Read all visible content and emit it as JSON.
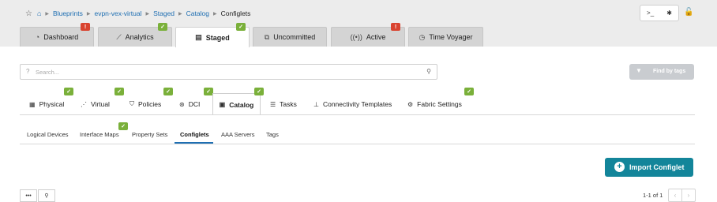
{
  "breadcrumb": {
    "items": [
      "Blueprints",
      "evpn-vex-virtual",
      "Staged",
      "Catalog",
      "Configlets"
    ]
  },
  "main_tabs": [
    {
      "label": "Dashboard",
      "icon": "gauge-icon",
      "badge": "warning"
    },
    {
      "label": "Analytics",
      "icon": "chart-icon",
      "badge": "ok"
    },
    {
      "label": "Staged",
      "icon": "document-icon",
      "badge": "ok",
      "active": true
    },
    {
      "label": "Uncommitted",
      "icon": "diff-icon",
      "badge": ""
    },
    {
      "label": "Active",
      "icon": "broadcast-icon",
      "badge": "warning"
    },
    {
      "label": "Time Voyager",
      "icon": "clock-icon",
      "badge": ""
    }
  ],
  "search": {
    "placeholder": "Search..."
  },
  "find_by_tags": {
    "label": "Find by tags"
  },
  "sub_tabs": [
    {
      "label": "Physical",
      "icon": "server-icon",
      "badge": "ok"
    },
    {
      "label": "Virtual",
      "icon": "network-icon",
      "badge": "ok"
    },
    {
      "label": "Policies",
      "icon": "shield-icon",
      "badge": "ok"
    },
    {
      "label": "DCI",
      "icon": "dci-icon",
      "badge": "ok"
    },
    {
      "label": "Catalog",
      "icon": "catalog-icon",
      "badge": "ok",
      "active": true
    },
    {
      "label": "Tasks",
      "icon": "list-icon",
      "badge": ""
    },
    {
      "label": "Connectivity Templates",
      "icon": "hierarchy-icon",
      "badge": ""
    },
    {
      "label": "Fabric Settings",
      "icon": "settings-icon",
      "badge": "ok"
    }
  ],
  "catalog_tabs": [
    {
      "label": "Logical Devices"
    },
    {
      "label": "Interface Maps",
      "badge": "ok"
    },
    {
      "label": "Property Sets"
    },
    {
      "label": "Configlets",
      "active": true
    },
    {
      "label": "AAA Servers"
    },
    {
      "label": "Tags"
    }
  ],
  "import_button": {
    "label": "Import Configlet"
  },
  "pagination": {
    "text": "1-1 of 1"
  },
  "colors": {
    "link": "#1f6fb2",
    "ok_badge": "#7ab03a",
    "warn_badge": "#d9432f",
    "primary_button": "#13859a"
  }
}
